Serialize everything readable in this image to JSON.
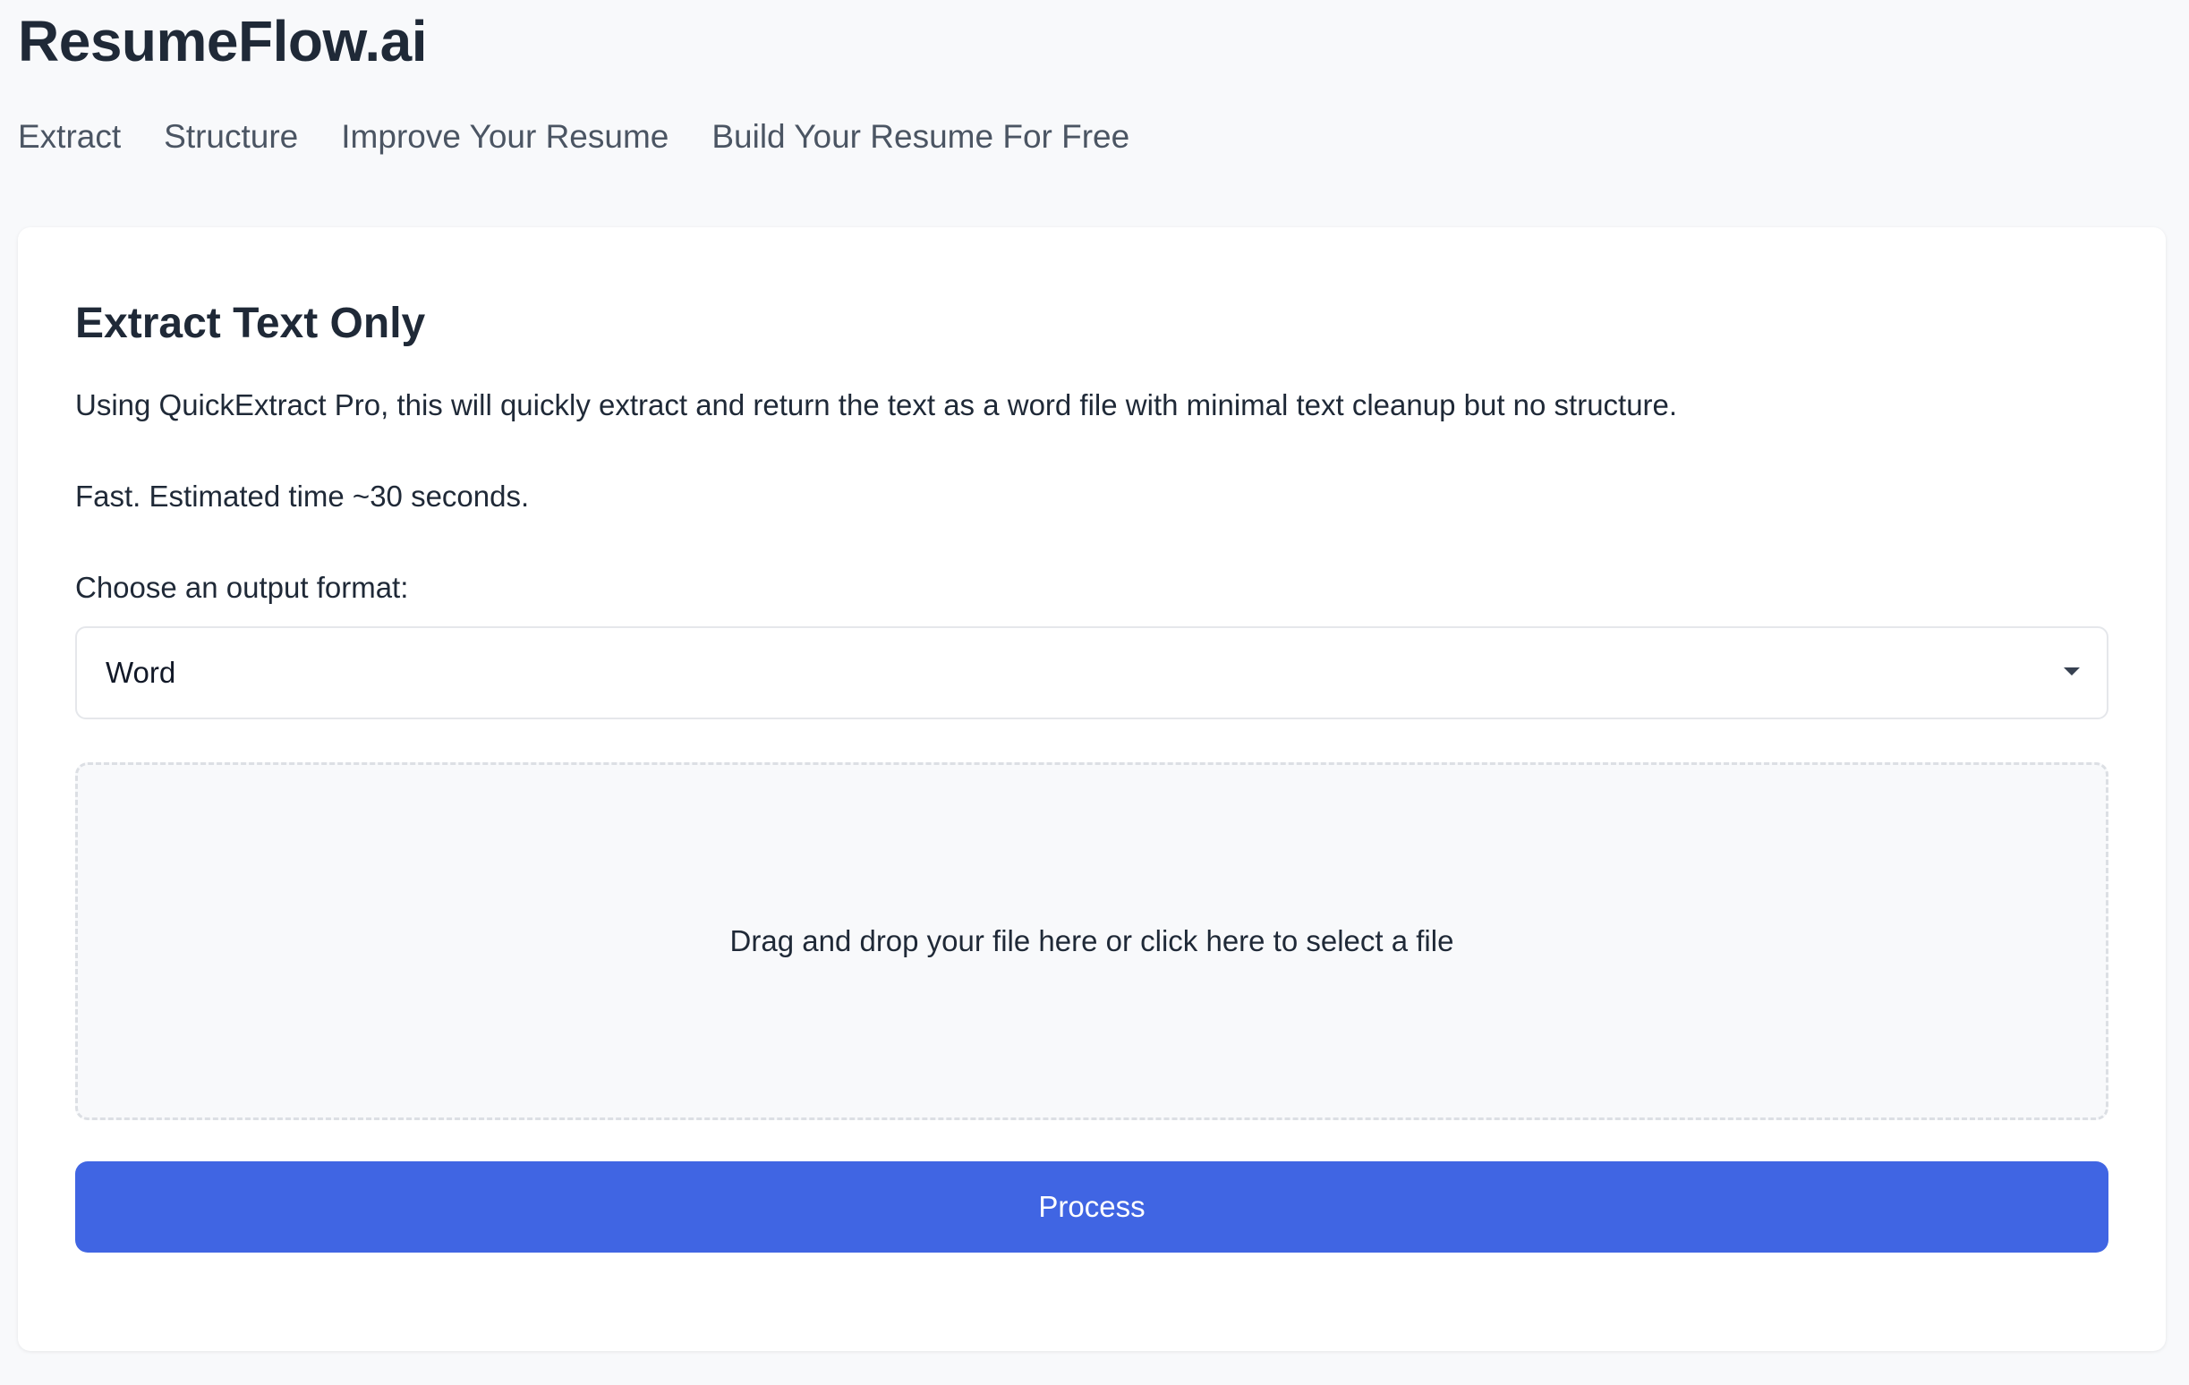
{
  "brand": {
    "name": "ResumeFlow.ai"
  },
  "nav": {
    "items": [
      {
        "label": "Extract"
      },
      {
        "label": "Structure"
      },
      {
        "label": "Improve Your Resume"
      },
      {
        "label": "Build Your Resume For Free"
      }
    ]
  },
  "card": {
    "title": "Extract Text Only",
    "description": "Using QuickExtract Pro, this will quickly extract and return the text as a word file with minimal text cleanup but no structure.",
    "time_note": "Fast. Estimated time ~30 seconds.",
    "format_label": "Choose an output format:",
    "format_selected": "Word",
    "dropzone_text": "Drag and drop your file here or click here to select a file",
    "process_label": "Process"
  },
  "colors": {
    "background": "#f8f9fb",
    "card": "#ffffff",
    "primary": "#4065e3",
    "text": "#1f2937",
    "nav_text": "#4b5563"
  },
  "icons": {
    "select_caret": "caret-down-icon"
  }
}
